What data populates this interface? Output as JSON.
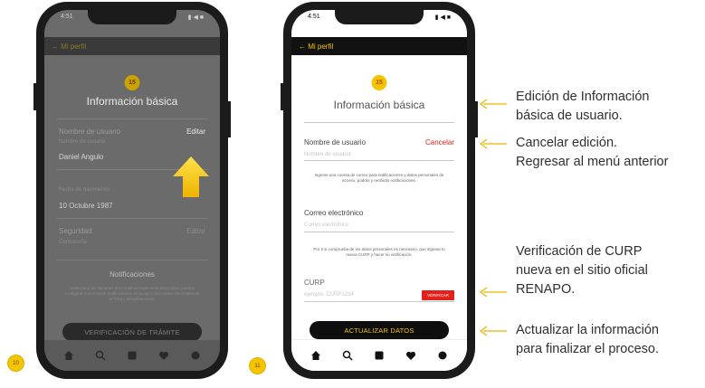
{
  "phone1": {
    "status_time": "4:51",
    "status_icons": "▮ ◀ ■",
    "back_label": "← Mi perfil",
    "step_badge": "15",
    "title": "Información básica",
    "username_label": "Nombre de usuario",
    "edit_label": "Editar",
    "username_value": "Daniel Angulo",
    "name_sub": "Nombre de usuario",
    "birth_label": "Fecha de nacimiento",
    "birth_value": "10 Octubre 1987",
    "password_label": "Seguridad",
    "password_edit": "Editar",
    "password_sub": "Contraseña",
    "notif_title": "Notificaciones",
    "notif_text": "Selecciona las opciones para notificaciones en tu dispositivo, puedes configurar como recibir notificaciones en la app y por correo electrónico en tu ficha y actualizaciones.",
    "button_label": "VERIFICACIÓN DE TRÁMITE"
  },
  "phone2": {
    "status_time": "4:51",
    "status_icons": "▮ ◀ ■",
    "back_label": "← Mi perfil",
    "step_badge": "15",
    "title": "Información básica",
    "username_label": "Nombre de usuario",
    "cancel_label": "Cancelar",
    "username_placeholder": "Nombre de usuario",
    "username_help": "Ingrese una cuenta de correo para notificaciones y datos personales de acceso, podrás y recibirás notificaciones.",
    "email_label": "Correo electrónico",
    "email_placeholder": "Correo electrónico",
    "email_help": "Por ti si comprueba de los datos personales es necesario, que ingresa tu nueva CURP y hacer su verificación.",
    "curp_label": "CURP",
    "curp_placeholder": "ejemplo: CURP1234",
    "verify_label": "VERIFICAR",
    "update_button": "ACTUALIZAR DATOS"
  },
  "steps": {
    "left": "10",
    "right": "11"
  },
  "annotations": [
    {
      "line1": "Edición de Información",
      "line2": "básica de usuario."
    },
    {
      "line1": "Cancelar edición.",
      "line2": "Regresar al menú anterior"
    },
    {
      "line1": "Verificación de CURP",
      "line2": "nueva en el sitio oficial",
      "line3": "RENAPO."
    },
    {
      "line1": "Actualizar la información",
      "line2": "para finalizar el proceso."
    }
  ],
  "colors": {
    "accent": "#f5c400",
    "danger": "#e2201c",
    "dark": "#0e0e0e",
    "overlay_gray": "#6b6b6b"
  }
}
